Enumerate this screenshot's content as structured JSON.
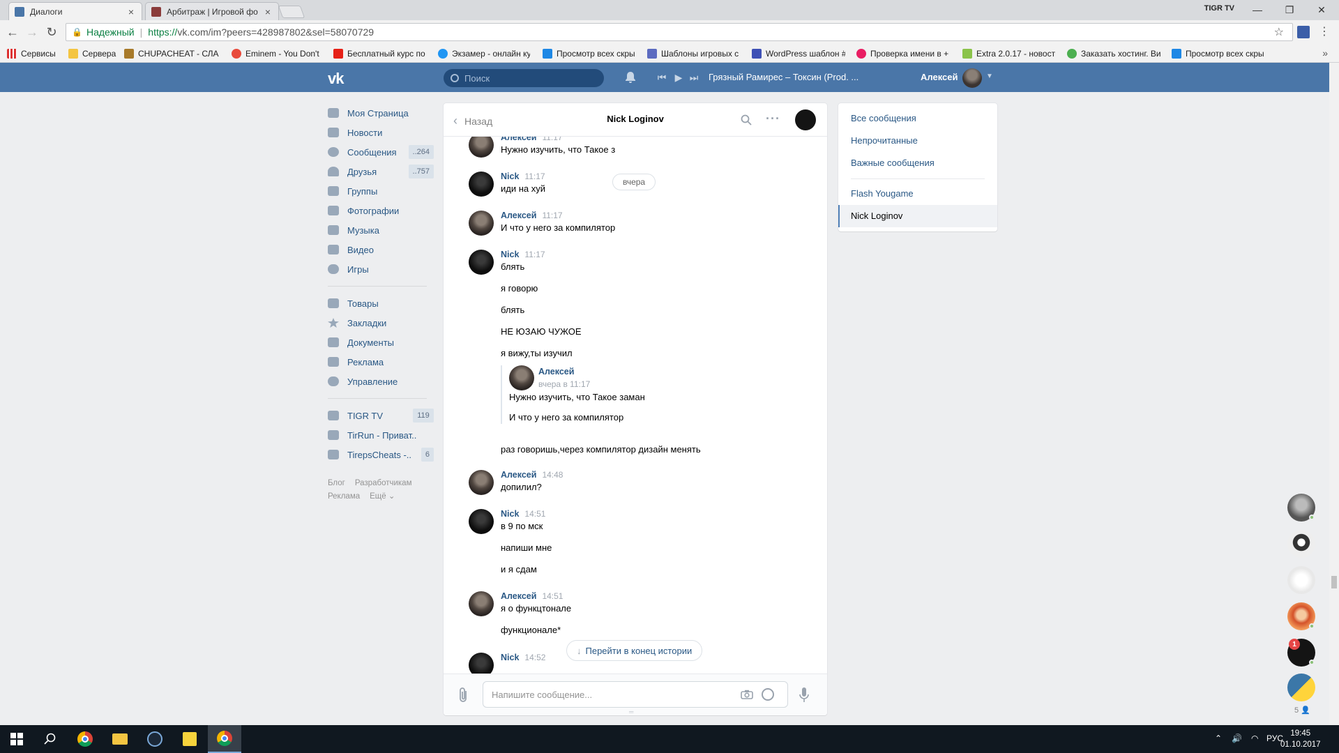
{
  "browser": {
    "tabs": [
      {
        "label": "Диалоги",
        "close": "×"
      },
      {
        "label": "Арбитраж | Игровой фо",
        "close": "×"
      }
    ],
    "window_title": "TIGR TV",
    "window_controls": [
      "—",
      "❐",
      "✕"
    ],
    "secure_label": "Надежный",
    "url_proto": "https://",
    "url_rest": "vk.com/im?peers=428987802&sel=58070729",
    "bookmarks": [
      "Сервисы",
      "Сервера",
      "CHUPACHEAT - СЛА,",
      "Eminem - You Don't",
      "Бесплатный курс по",
      "Экзамер - онлайн ку",
      "Просмотр всех скры",
      "Шаблоны игровых с",
      "WordPress шаблон #",
      "Проверка имени в +",
      "Extra 2.0.17 - новост",
      "Заказать хостинг. Ви",
      "Просмотр всех скры"
    ],
    "more": "»"
  },
  "vk": {
    "logo": "vk",
    "search_placeholder": "Поиск",
    "track": "Грязный Рамирес – Токсин (Prod. ...",
    "user_name": "Алексей",
    "accent": "#4a76a8",
    "link_color": "#2a5885"
  },
  "left_nav": {
    "items": [
      {
        "label": "Моя Страница",
        "badge": ""
      },
      {
        "label": "Новости",
        "badge": ""
      },
      {
        "label": "Сообщения",
        "badge": "..264"
      },
      {
        "label": "Друзья",
        "badge": "..757"
      },
      {
        "label": "Группы",
        "badge": ""
      },
      {
        "label": "Фотографии",
        "badge": ""
      },
      {
        "label": "Музыка",
        "badge": ""
      },
      {
        "label": "Видео",
        "badge": ""
      },
      {
        "label": "Игры",
        "badge": ""
      }
    ],
    "items2": [
      {
        "label": "Товары"
      },
      {
        "label": "Закладки"
      },
      {
        "label": "Документы"
      },
      {
        "label": "Реклама"
      },
      {
        "label": "Управление"
      }
    ],
    "groups": [
      {
        "label": "TIGR TV",
        "badge": "119"
      },
      {
        "label": "TirRun - Приват..",
        "badge": ""
      },
      {
        "label": "TirepsCheats -..",
        "badge": "6"
      }
    ],
    "footer": [
      "Блог",
      "Разработчикам",
      "Реклама",
      "Ещё ⌄"
    ]
  },
  "chat": {
    "back_label": "Назад",
    "title": "Nick Loginov",
    "date_pill": "вчера",
    "jump_label": "Перейти в конец истории",
    "input_placeholder": "Напишите сообщение...",
    "messages": [
      {
        "author": "Алексей",
        "time": "11:17",
        "lines": [
          "Нужно изучить, что Такое з"
        ]
      },
      {
        "author": "Nick",
        "time": "11:17",
        "lines": [
          "иди на хуй"
        ]
      },
      {
        "author": "Алексей",
        "time": "11:17",
        "lines": [
          "И что у него за компилятор"
        ]
      },
      {
        "author": "Nick",
        "time": "11:17",
        "lines": [
          "блять",
          "я говорю",
          "блять",
          "НЕ ЮЗАЮ ЧУЖОЕ",
          "я вижу,ты изучил"
        ]
      },
      {
        "author": "Алексей",
        "time": "14:48",
        "lines": [
          "допилил?"
        ]
      },
      {
        "author": "Nick",
        "time": "14:51",
        "lines": [
          "в 9 по мск",
          "напиши мне",
          "и я сдам"
        ]
      },
      {
        "author": "Алексей",
        "time": "14:51",
        "lines": [
          "я о функцтонале",
          "функционале*"
        ]
      },
      {
        "author": "Nick",
        "time": "14:52",
        "lines": []
      }
    ],
    "forward": {
      "author": "Алексей",
      "date": "вчера в 11:17",
      "lines": [
        "Нужно изучить, что Такое заман",
        "И что у него за компилятор"
      ]
    },
    "after_forward": "раз говоришь,через компилятор дизайн менять"
  },
  "filters": {
    "items": [
      "Все сообщения",
      "Непрочитанные",
      "Важные сообщения",
      "Flash Yougame"
    ],
    "active": "Nick Loginov"
  },
  "right_bar": {
    "count": "5 👤",
    "notif": "1"
  },
  "taskbar": {
    "lang": "РУС",
    "time": "19:45",
    "date": "01.10.2017"
  }
}
